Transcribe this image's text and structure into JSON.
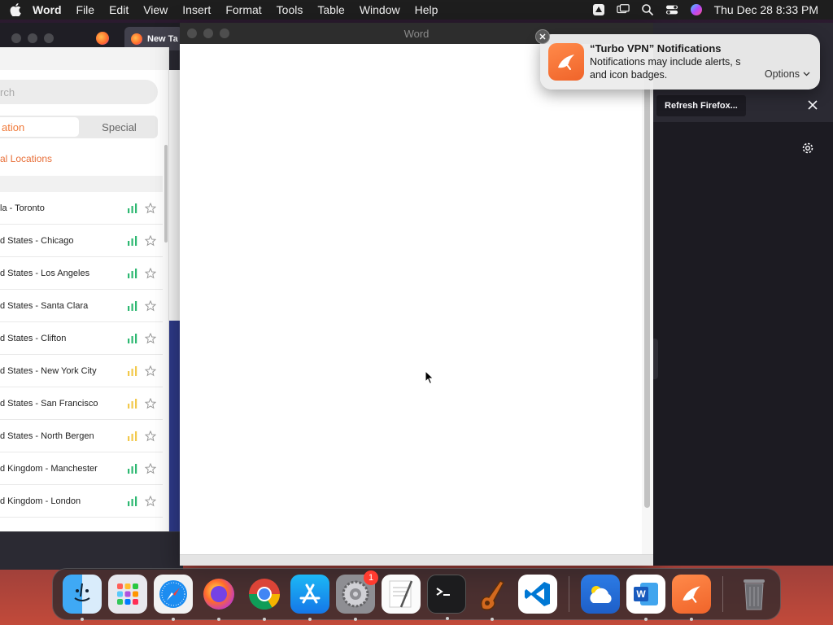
{
  "menubar": {
    "app_name": "Word",
    "items": [
      "File",
      "Edit",
      "View",
      "Insert",
      "Format",
      "Tools",
      "Table",
      "Window",
      "Help"
    ],
    "clock": "Thu Dec 28  8:33 PM"
  },
  "browser": {
    "tab_title": "New Ta"
  },
  "vpn": {
    "search_placeholder": "rch",
    "segments": [
      "ation",
      "Special"
    ],
    "locations_header": "al Locations",
    "servers": [
      {
        "name": "la - Toronto",
        "signal": "green"
      },
      {
        "name": "d States - Chicago",
        "signal": "green"
      },
      {
        "name": "d States - Los Angeles",
        "signal": "green"
      },
      {
        "name": "d States - Santa Clara",
        "signal": "green"
      },
      {
        "name": "d States - Clifton",
        "signal": "green"
      },
      {
        "name": "d States - New York City",
        "signal": "yellow"
      },
      {
        "name": "d States - San Francisco",
        "signal": "yellow"
      },
      {
        "name": "d States - North Bergen",
        "signal": "yellow"
      },
      {
        "name": "d Kingdom - Manchester",
        "signal": "green"
      },
      {
        "name": "d Kingdom - London",
        "signal": "green"
      }
    ],
    "colors": {
      "accent": "#f07a3a",
      "signal_green": "#2eb872",
      "signal_yellow": "#f2c94c"
    }
  },
  "word": {
    "window_title": "Word"
  },
  "firefox_panel": {
    "refresh_label": "Refresh Firefox..."
  },
  "notification": {
    "title": "“Turbo VPN” Notifications",
    "body_line1": "Notifications may include alerts, s",
    "body_line2": "and icon badges.",
    "options_label": "Options"
  },
  "dock": {
    "apps": [
      "finder-icon",
      "launchpad-icon",
      "safari-icon",
      "firefox-icon",
      "chrome-icon",
      "app-store-icon",
      "system-settings-icon",
      "textedit-icon",
      "terminal-icon",
      "garageband-icon",
      "vscode-icon",
      "weather-icon",
      "word-icon",
      "turbo-vpn-icon",
      "trash-icon"
    ],
    "settings_badge": "1"
  }
}
